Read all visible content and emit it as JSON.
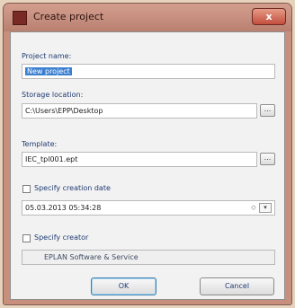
{
  "window": {
    "title": "Create project",
    "close_label": "x"
  },
  "form": {
    "project_name": {
      "label": "Project name:",
      "value": "New project"
    },
    "storage_location": {
      "label": "Storage location:",
      "value": "C:\\Users\\EPP\\Desktop",
      "browse_label": "..."
    },
    "template": {
      "label": "Template:",
      "value": "IEC_tpl001.ept",
      "browse_label": "..."
    },
    "creation_date": {
      "label": "Specify creation date",
      "checked": false,
      "value": "05.03.2013 05:34:28"
    },
    "creator": {
      "label": "Specify creator",
      "checked": false,
      "value": "EPLAN Software & Service"
    }
  },
  "buttons": {
    "ok": "OK",
    "cancel": "Cancel"
  },
  "colors": {
    "frame": "#c98f7d",
    "client": "#f2f2f2",
    "selection": "#3b7fd1",
    "label": "#1f3b72"
  }
}
